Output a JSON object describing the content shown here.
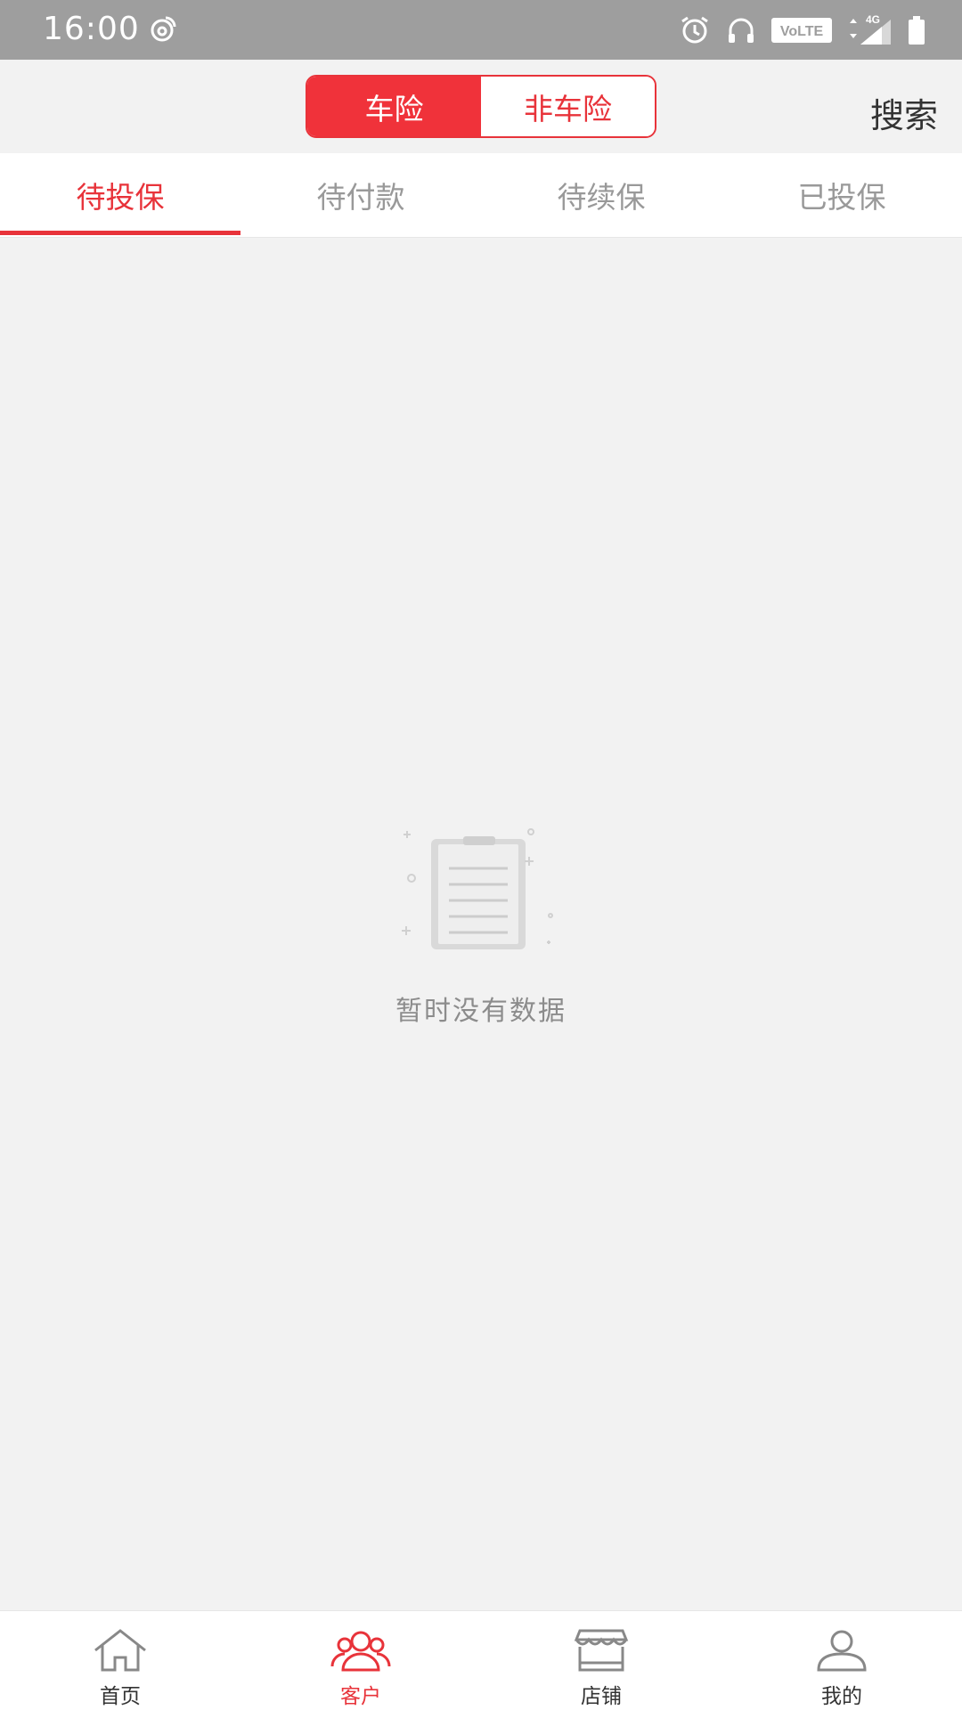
{
  "status_bar": {
    "time": "16:00",
    "network_label": "VoLTE",
    "signal_label": "4G",
    "icons": [
      "weibo-icon",
      "alarm-icon",
      "headphones-icon",
      "volte-icon",
      "signal-icon",
      "battery-icon"
    ]
  },
  "top_bar": {
    "segments": [
      {
        "label": "车险",
        "active": true
      },
      {
        "label": "非车险",
        "active": false
      }
    ],
    "search_label": "搜索"
  },
  "tabs": [
    {
      "label": "待投保",
      "active": true
    },
    {
      "label": "待付款",
      "active": false
    },
    {
      "label": "待续保",
      "active": false
    },
    {
      "label": "已投保",
      "active": false
    }
  ],
  "empty_state": {
    "message": "暂时没有数据",
    "icon": "clipboard-icon"
  },
  "bottom_nav": [
    {
      "label": "首页",
      "icon": "home-icon",
      "active": false
    },
    {
      "label": "客户",
      "icon": "customers-icon",
      "active": true
    },
    {
      "label": "店铺",
      "icon": "store-icon",
      "active": false
    },
    {
      "label": "我的",
      "icon": "profile-icon",
      "active": false
    }
  ],
  "colors": {
    "accent": "#e8333a",
    "status_bar": "#9e9e9e",
    "background": "#f2f2f2",
    "inactive_text": "#999999"
  }
}
